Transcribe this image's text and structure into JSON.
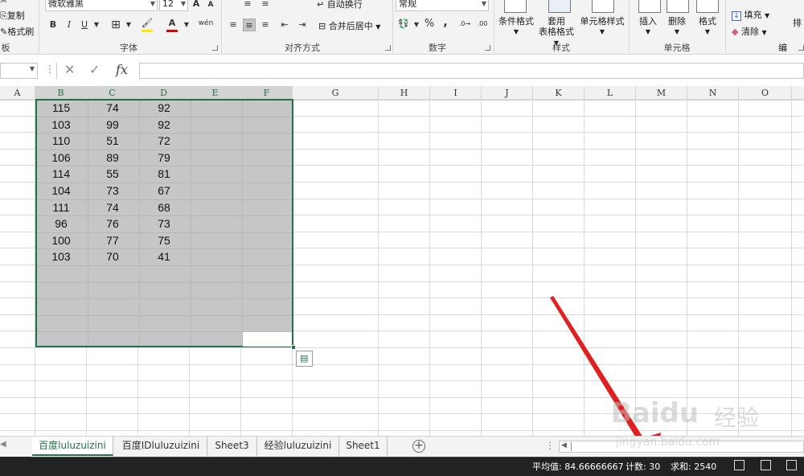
{
  "ribbon": {
    "clipboard": {
      "label": "板",
      "copy": "复制",
      "format_painter": "格式刷"
    },
    "font": {
      "label": "字体",
      "font_name": "微软雅黑",
      "font_size": "12",
      "bold": "B",
      "italic": "I",
      "underline": "U",
      "grow": "A",
      "shrink": "A",
      "font_color_glyph": "A",
      "wen": "wén"
    },
    "alignment": {
      "label": "对齐方式",
      "wrap": "自动换行",
      "merge": "合并后居中"
    },
    "number": {
      "label": "数字",
      "format": "常规",
      "percent": "%",
      "comma": ","
    },
    "styles": {
      "label": "样式",
      "conditional": "条件格式",
      "table_line1": "套用",
      "table_line2": "表格格式",
      "cell_styles": "单元格样式"
    },
    "cells": {
      "label": "单元格",
      "insert": "插入",
      "delete": "删除",
      "format": "格式"
    },
    "editing": {
      "fill": "填充",
      "clear": "清除",
      "sort_partial": "排"
    }
  },
  "formula_bar": {
    "fx": "fx",
    "cancel": "✕",
    "enter": "✓"
  },
  "columns": [
    "A",
    "B",
    "C",
    "D",
    "E",
    "F",
    "G",
    "H",
    "I",
    "J",
    "K",
    "L",
    "M",
    "N",
    "O"
  ],
  "rows": [
    [
      "115",
      "74",
      "92"
    ],
    [
      "103",
      "99",
      "92"
    ],
    [
      "110",
      "51",
      "72"
    ],
    [
      "106",
      "89",
      "79"
    ],
    [
      "114",
      "55",
      "81"
    ],
    [
      "104",
      "73",
      "67"
    ],
    [
      "111",
      "74",
      "68"
    ],
    [
      "96",
      "76",
      "73"
    ],
    [
      "100",
      "77",
      "75"
    ],
    [
      "103",
      "70",
      "41"
    ]
  ],
  "sheets": [
    "百度luluzuizini",
    "百度IDluluzuizini",
    "Sheet3",
    "经验luluzuizini",
    "Sheet1"
  ],
  "active_sheet": "百度luluzuizini",
  "status": {
    "average": "平均值: 84.66666667",
    "count": "计数: 30",
    "sum": "求和: 2540"
  },
  "watermark": {
    "brand": "Baidu",
    "brand_cn": "经验",
    "url": "jingyan.baidu.com"
  },
  "colors": {
    "accent": "#217346",
    "selection": "#c6c6c6",
    "arrow": "#e02020"
  }
}
